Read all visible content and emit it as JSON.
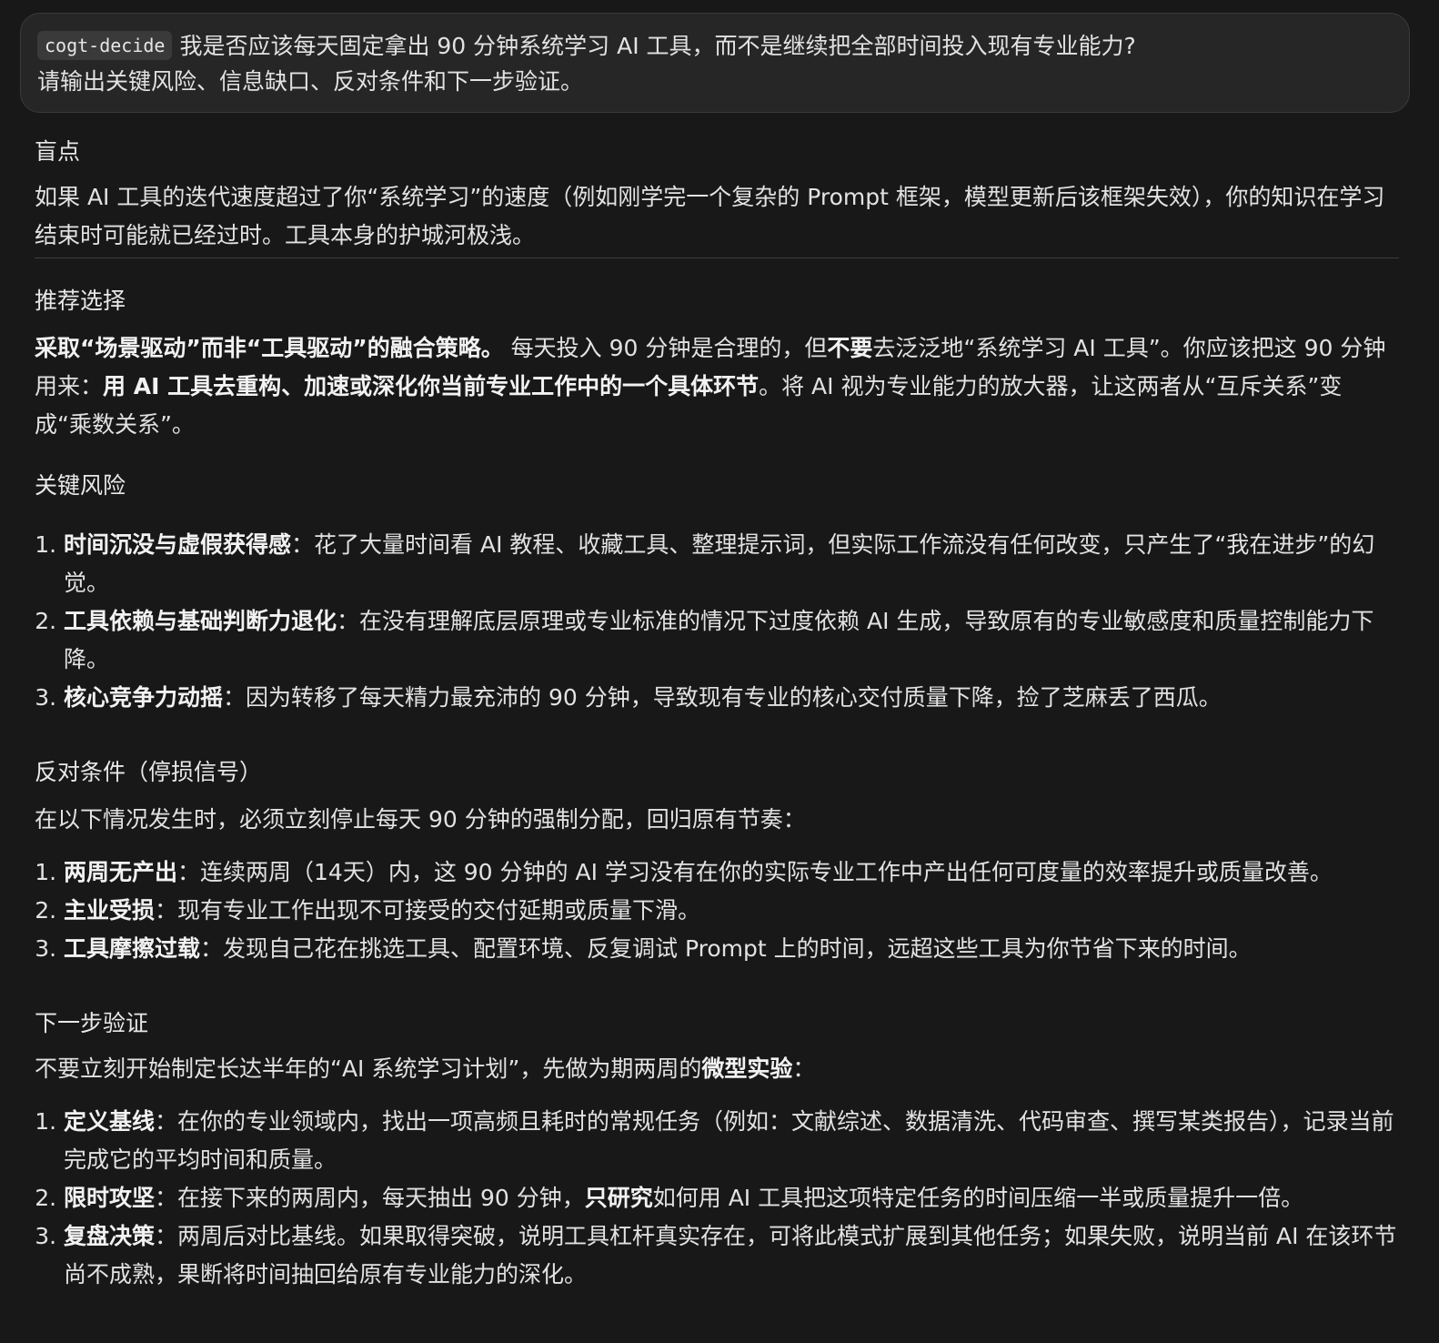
{
  "prompt": {
    "command": "cogt-decide",
    "line1": "我是否应该每天固定拿出 90 分钟系统学习 AI 工具，而不是继续把全部时间投入现有专业能力?",
    "line2": "请输出关键风险、信息缺口、反对条件和下一步验证。"
  },
  "blindspot": {
    "heading": "盲点",
    "text": "如果 AI 工具的迭代速度超过了你“系统学习”的速度（例如刚学完一个复杂的 Prompt 框架，模型更新后该框架失效），你的知识在学习结束时可能就已经过时。工具本身的护城河极浅。"
  },
  "recommendation": {
    "heading": "推荐选择",
    "lead_bold": "采取“场景驱动”而非“工具驱动”的融合策略。",
    "t1": " 每天投入 90 分钟是合理的，但",
    "bold2": "不要",
    "t2": "去泛泛地“系统学习 AI 工具”。你应该把这 90 分钟用来：",
    "bold3": "用 AI 工具去重构、加速或深化你当前专业工作中的一个具体环节",
    "t3": "。将 AI 视为专业能力的放大器，让这两者从“互斥关系”变成“乘数关系”。"
  },
  "risks": {
    "heading": "关键风险",
    "items": [
      {
        "title": "时间沉没与虚假获得感",
        "text": "：花了大量时间看 AI 教程、收藏工具、整理提示词，但实际工作流没有任何改变，只产生了“我在进步”的幻觉。"
      },
      {
        "title": "工具依赖与基础判断力退化",
        "text": "：在没有理解底层原理或专业标准的情况下过度依赖 AI 生成，导致原有的专业敏感度和质量控制能力下降。"
      },
      {
        "title": "核心竞争力动摇",
        "text": "：因为转移了每天精力最充沛的 90 分钟，导致现有专业的核心交付质量下降，捡了芝麻丢了西瓜。"
      }
    ]
  },
  "counter": {
    "heading": "反对条件（停损信号）",
    "intro": "在以下情况发生时，必须立刻停止每天 90 分钟的强制分配，回归原有节奏：",
    "items": [
      {
        "title": "两周无产出",
        "text": "：连续两周（14天）内，这 90 分钟的 AI 学习没有在你的实际专业工作中产出任何可度量的效率提升或质量改善。"
      },
      {
        "title": "主业受损",
        "text": "：现有专业工作出现不可接受的交付延期或质量下滑。"
      },
      {
        "title": "工具摩擦过载",
        "text": "：发现自己花在挑选工具、配置环境、反复调试 Prompt 上的时间，远超这些工具为你节省下来的时间。"
      }
    ]
  },
  "next": {
    "heading": "下一步验证",
    "intro_a": "不要立刻开始制定长达半年的“AI 系统学习计划”，先做为期两周的",
    "intro_bold": "微型实验",
    "intro_b": "：",
    "items": [
      {
        "title": "定义基线",
        "pre": "：在你的专业领域内，找出一项高频且耗时的常规任务（例如：文献综述、数据清洗、代码审查、撰写某类报告），记录当前完成它的平均时间和质量。",
        "bold": "",
        "post": ""
      },
      {
        "title": "限时攻坚",
        "pre": "：在接下来的两周内，每天抽出 90 分钟，",
        "bold": "只研究",
        "post": "如何用 AI 工具把这项特定任务的时间压缩一半或质量提升一倍。"
      },
      {
        "title": "复盘决策",
        "pre": "：两周后对比基线。如果取得突破，说明工具杠杆真实存在，可将此模式扩展到其他任务；如果失败，说明当前 AI 在该环节尚不成熟，果断将时间抽回给原有专业能力的深化。",
        "bold": "",
        "post": ""
      }
    ]
  }
}
